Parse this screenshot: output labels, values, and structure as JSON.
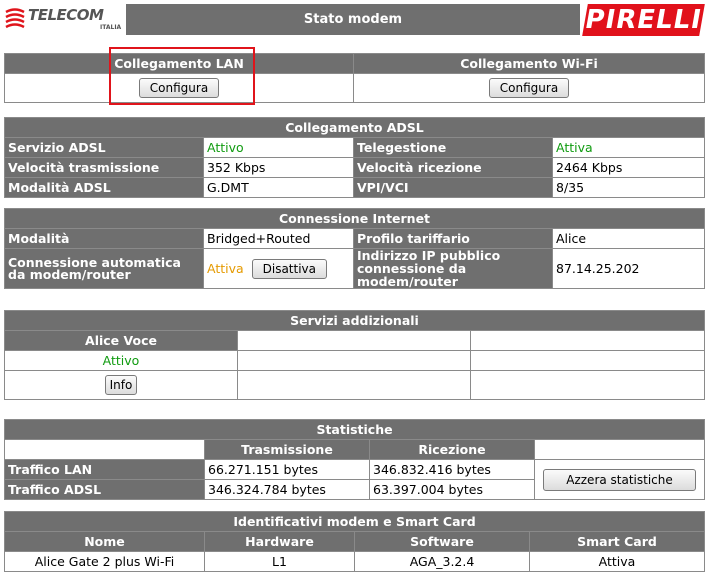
{
  "header": {
    "telecom_logo": "TELECOM",
    "telecom_sub": "ITALIA",
    "title": "Stato modem",
    "pirelli_logo": "PIRELLI"
  },
  "connections": {
    "lan_label": "Collegamento LAN",
    "wifi_label": "Collegamento Wi-Fi",
    "lan_button": "Configura",
    "wifi_button": "Configura"
  },
  "adsl": {
    "title": "Collegamento ADSL",
    "rows": [
      {
        "l1": "Servizio ADSL",
        "v1": "Attivo",
        "l2": "Telegestione",
        "v2": "Attiva"
      },
      {
        "l1": "Velocità trasmissione",
        "v1": "352 Kbps",
        "l2": "Velocità ricezione",
        "v2": "2464 Kbps"
      },
      {
        "l1": "Modalità ADSL",
        "v1": "G.DMT",
        "l2": "VPI/VCI",
        "v2": "8/35"
      }
    ]
  },
  "internet": {
    "title": "Connessione Internet",
    "mode_label": "Modalità",
    "mode_value": "Bridged+Routed",
    "profile_label": "Profilo tariffario",
    "profile_value": "Alice",
    "auto_label": "Connessione automatica da modem/router",
    "auto_status": "Attiva",
    "auto_button": "Disattiva",
    "ip_label": "Indirizzo IP pubblico connessione da modem/router",
    "ip_value": "87.14.25.202"
  },
  "services": {
    "title": "Servizi addizionali",
    "voice_label": "Alice Voce",
    "voice_status": "Attivo",
    "info_button": "Info"
  },
  "stats": {
    "title": "Statistiche",
    "tx_header": "Trasmissione",
    "rx_header": "Ricezione",
    "lan_label": "Traffico LAN",
    "lan_tx": "66.271.151 bytes",
    "lan_rx": "346.832.416 bytes",
    "adsl_label": "Traffico ADSL",
    "adsl_tx": "346.324.784 bytes",
    "adsl_rx": "63.397.004 bytes",
    "reset_button": "Azzera statistiche"
  },
  "ids": {
    "title": "Identificativi modem e Smart Card",
    "headers": [
      "Nome",
      "Hardware",
      "Software",
      "Smart Card"
    ],
    "values": [
      "Alice Gate 2 plus Wi-Fi",
      "L1",
      "AGA_3.2.4",
      "Attiva"
    ]
  },
  "colors": {
    "header_gray": "#6f6f6f",
    "status_green": "#109b10",
    "status_orange": "#e59a00",
    "pirelli_red": "#e1111b",
    "highlight_red": "#e0141b"
  }
}
